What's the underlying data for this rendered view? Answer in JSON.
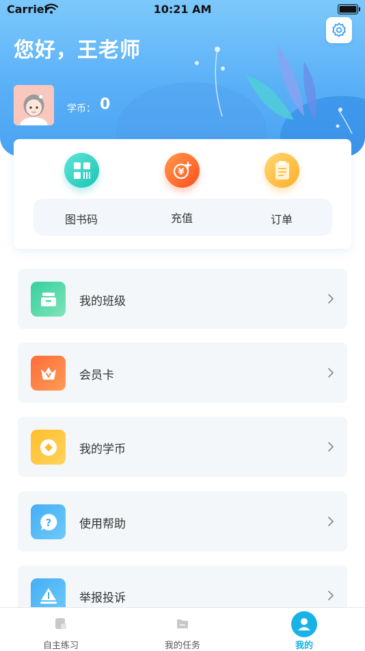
{
  "status_bar": {
    "carrier": "Carrier",
    "time": "10:21 AM"
  },
  "header": {
    "greeting": "您好，王老师",
    "coin_label": "学币：",
    "coin_value": "0"
  },
  "quick_actions": [
    {
      "label": "图书码",
      "icon": "qr-code-icon",
      "color": "#2fd4c4"
    },
    {
      "label": "充值",
      "icon": "yuan-plus-icon",
      "color": "#ff6a2a"
    },
    {
      "label": "订单",
      "icon": "clipboard-icon",
      "color": "#ffc14a"
    }
  ],
  "menu": [
    {
      "label": "我的班级",
      "icon": "class-icon",
      "color": "#3fd1a3"
    },
    {
      "label": "会员卡",
      "icon": "crown-icon",
      "color": "#ff7a3d"
    },
    {
      "label": "我的学币",
      "icon": "coin-icon",
      "color": "#ffb72d"
    },
    {
      "label": "使用帮助",
      "icon": "help-icon",
      "color": "#4fb6f6"
    },
    {
      "label": "举报投诉",
      "icon": "report-icon",
      "color": "#4fb6f6"
    }
  ],
  "tabs": [
    {
      "label": "自主练习",
      "icon": "practice-icon",
      "active": false
    },
    {
      "label": "我的任务",
      "icon": "task-icon",
      "active": false
    },
    {
      "label": "我的",
      "icon": "profile-icon",
      "active": true
    }
  ],
  "colors": {
    "accent": "#17b3e6",
    "header_top": "#7cc8fb",
    "header_bottom": "#4aa3f3"
  }
}
